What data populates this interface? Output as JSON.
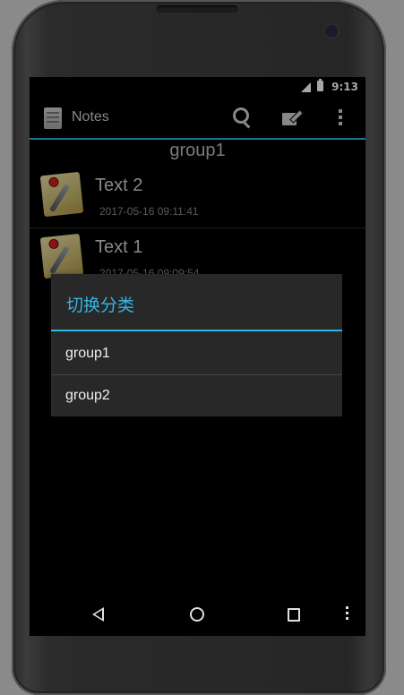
{
  "status_bar": {
    "time": "9:13"
  },
  "action_bar": {
    "title": "Notes",
    "icons": [
      "notes-app-icon",
      "search-icon",
      "edit-note-icon",
      "overflow-menu-icon"
    ]
  },
  "list": {
    "group_header": "group1",
    "notes": [
      {
        "title": "Text 2",
        "date": "2017-05-16 09:11:41"
      },
      {
        "title": "Text 1",
        "date": "2017-05-16 09:09:54"
      }
    ]
  },
  "dialog": {
    "title": "切换分类",
    "items": [
      "group1",
      "group2"
    ]
  },
  "colors": {
    "accent": "#33b5e5",
    "dialog_bg": "#282828",
    "screen_bg": "#000000"
  },
  "nav_icons": [
    "back-icon",
    "home-icon",
    "recents-icon",
    "menu-icon"
  ]
}
